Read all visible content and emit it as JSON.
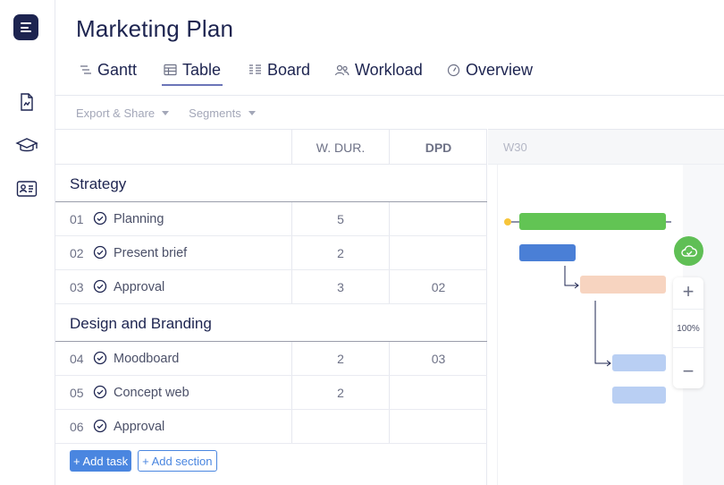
{
  "page": {
    "title": "Marketing Plan"
  },
  "tabs": [
    {
      "label": "Gantt",
      "icon": "gantt-icon"
    },
    {
      "label": "Table",
      "icon": "table-icon",
      "active": true
    },
    {
      "label": "Board",
      "icon": "board-icon"
    },
    {
      "label": "Workload",
      "icon": "people-icon"
    },
    {
      "label": "Overview",
      "icon": "gauge-icon"
    }
  ],
  "toolbar": {
    "export_label": "Export & Share",
    "segments_label": "Segments"
  },
  "table": {
    "columns": {
      "wdur": "W. DUR.",
      "dpd": "DPD"
    },
    "sections": [
      {
        "title": "Strategy",
        "rows": [
          {
            "num": "01",
            "name": "Planning",
            "wdur": "5",
            "dpd": ""
          },
          {
            "num": "02",
            "name": "Present brief",
            "wdur": "2",
            "dpd": ""
          },
          {
            "num": "03",
            "name": "Approval",
            "wdur": "3",
            "dpd": "02"
          }
        ]
      },
      {
        "title": "Design and Branding",
        "rows": [
          {
            "num": "04",
            "name": "Moodboard",
            "wdur": "2",
            "dpd": "03"
          },
          {
            "num": "05",
            "name": "Concept web",
            "wdur": "2",
            "dpd": ""
          },
          {
            "num": "06",
            "name": "Approval",
            "wdur": "",
            "dpd": ""
          }
        ]
      }
    ],
    "add_task_label": "+ Add task",
    "add_section_label": "+ Add section"
  },
  "gantt": {
    "week_label": "W30",
    "zoom_label": "100%",
    "bar_colors": [
      "#62c454",
      "#4a7fd6",
      "#f7d4c0",
      "#b9cff3",
      "#b9cff3"
    ]
  },
  "colors": {
    "accent": "#4a86e0",
    "brand": "#1d2450",
    "success": "#62c454"
  }
}
